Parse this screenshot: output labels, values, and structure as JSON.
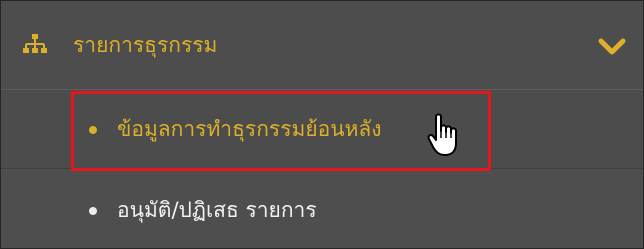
{
  "menu": {
    "header_label": "รายการธุรกรรม",
    "header_icon": "organization-chart-icon",
    "expand_icon": "chevron-down-icon",
    "items": [
      {
        "label": "ข้อมูลการทำธุรกรรมย้อนหลัง",
        "state": "highlighted"
      },
      {
        "label": "อนุมัติ/ปฏิเสธ รายการ",
        "state": "normal"
      }
    ]
  },
  "colors": {
    "menu_background": "#4e4e4e",
    "accent": "#ddb02a",
    "item_text": "#f2f2f2",
    "highlight_border": "#e4151b"
  },
  "cursor": "hand-pointer-icon"
}
